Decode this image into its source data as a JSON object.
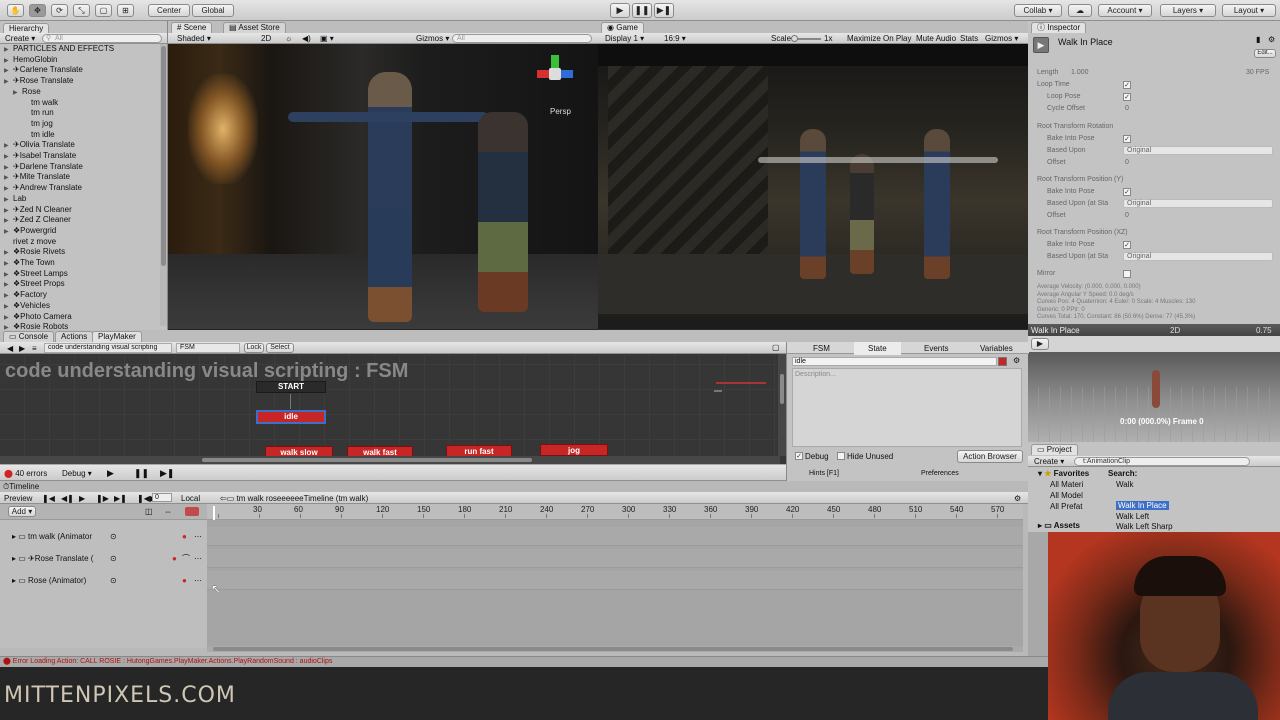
{
  "toolbar": {
    "center_label": "Center",
    "global_label": "Global",
    "collab_label": "Collab",
    "account_label": "Account",
    "layers_label": "Layers",
    "layout_label": "Layout"
  },
  "hierarchy": {
    "tab": "Hierarchy",
    "create_label": "Create",
    "search_placeholder": "All",
    "items": [
      {
        "label": "PARTICLES AND EFFECTS",
        "indent": 1,
        "arrow": true
      },
      {
        "label": "HemoGlobin",
        "indent": 1,
        "arrow": true
      },
      {
        "label": "✈Carlene Translate",
        "indent": 1,
        "arrow": true
      },
      {
        "label": "✈Rose Translate",
        "indent": 1,
        "arrow": true
      },
      {
        "label": "Rose",
        "indent": 2,
        "arrow": true
      },
      {
        "label": "tm walk",
        "indent": 3,
        "arrow": false
      },
      {
        "label": "tm run",
        "indent": 3,
        "arrow": false
      },
      {
        "label": "tm jog",
        "indent": 3,
        "arrow": false
      },
      {
        "label": "tm idle",
        "indent": 3,
        "arrow": false
      },
      {
        "label": "✈Olivia Translate",
        "indent": 1,
        "arrow": true
      },
      {
        "label": "✈Isabel Translate",
        "indent": 1,
        "arrow": true
      },
      {
        "label": "✈Darlene Translate",
        "indent": 1,
        "arrow": true
      },
      {
        "label": "✈Mite Translate",
        "indent": 1,
        "arrow": true
      },
      {
        "label": "✈Andrew Translate",
        "indent": 1,
        "arrow": true
      },
      {
        "label": "Lab",
        "indent": 1,
        "arrow": true
      },
      {
        "label": "✈Zed N Cleaner",
        "indent": 1,
        "arrow": true
      },
      {
        "label": "✈Zed Z Cleaner",
        "indent": 1,
        "arrow": true
      },
      {
        "label": "❖Powergrid",
        "indent": 1,
        "arrow": true
      },
      {
        "label": "rivet z move",
        "indent": 1,
        "arrow": false
      },
      {
        "label": "❖Rosie Rivets",
        "indent": 1,
        "arrow": true
      },
      {
        "label": "❖The Town",
        "indent": 1,
        "arrow": true
      },
      {
        "label": "❖Street Lamps",
        "indent": 1,
        "arrow": true
      },
      {
        "label": "❖Street Props",
        "indent": 1,
        "arrow": true
      },
      {
        "label": "❖Factory",
        "indent": 1,
        "arrow": true
      },
      {
        "label": "❖Vehicles",
        "indent": 1,
        "arrow": true
      },
      {
        "label": "❖Photo Camera",
        "indent": 1,
        "arrow": true
      },
      {
        "label": "❖Rosie Robots",
        "indent": 1,
        "arrow": true
      }
    ]
  },
  "scene": {
    "tab_scene": "Scene",
    "tab_asset_store": "Asset Store",
    "shaded": "Shaded",
    "mode_2d": "2D",
    "gizmos": "Gizmos",
    "search_placeholder": "All",
    "persp": "Persp"
  },
  "game": {
    "tab": "Game",
    "display": "Display 1",
    "aspect": "16:9",
    "scale_label": "Scale",
    "scale_value": "1x",
    "maximize": "Maximize On Play",
    "mute": "Mute Audio",
    "stats": "Stats",
    "gizmos": "Gizmos"
  },
  "inspector": {
    "tab": "Inspector",
    "title": "Walk In Place",
    "edit": "Edit...",
    "length_label": "Length",
    "length_value": "1.000",
    "fps": "30 FPS",
    "loop_time": "Loop Time",
    "loop_pose": "Loop Pose",
    "cycle_offset": "Cycle Offset",
    "cycle_offset_value": "0",
    "rtr_header": "Root Transform Rotation",
    "bake_into_pose": "Bake Into Pose",
    "based_upon": "Based Upon",
    "based_upon_value": "Original",
    "offset": "Offset",
    "offset_value": "0",
    "rty_header": "Root Transform Position (Y)",
    "based_upon_start": "Based Upon (at Sta",
    "rtxz_header": "Root Transform Position (XZ)",
    "mirror": "Mirror",
    "stats": [
      "Average Velocity: (0.000, 0.000, 0.000)",
      "Average Angular Y Speed: 0.0 deg/s",
      "Curves Pos: 4 Quaternion: 4 Euler: 0 Scale: 4 Muscles: 130",
      "Generic: 0 PPtr: 0",
      "Curves Total: 170, Constant: 86 (50.6%) Dense: 77 (45.3%)"
    ]
  },
  "preview": {
    "title": "Walk In Place",
    "mode_2d": "2D",
    "speed": "0.75",
    "frame_text": "0:00 (000.0%) Frame 0"
  },
  "tabs_bottom": {
    "console": "Console",
    "actions": "Actions",
    "playmaker": "PlayMaker"
  },
  "playmaker": {
    "fsm_path": "code understanding visual scripting",
    "fsm_name": "FSM",
    "lock": "Lock",
    "select": "Select",
    "canvas_title": "code understanding visual scripting : FSM",
    "start": "START",
    "states": [
      "idle",
      "walk slow",
      "walk fast",
      "run fast",
      "jog"
    ],
    "errors": "40 errors",
    "debug": "Debug",
    "panel_tabs": [
      "FSM",
      "State",
      "Events",
      "Variables"
    ],
    "state_name": "idle",
    "description_placeholder": "Description...",
    "debug_check": "Debug",
    "hide_unused": "Hide Unused",
    "action_browser": "Action Browser",
    "hints": "Hints [F1]",
    "preferences": "Preferences"
  },
  "timeline": {
    "tab": "Timeline",
    "preview": "Preview",
    "frame": "0",
    "local": "Local",
    "asset": "tm walk roseeeeeeTimeline (tm walk)",
    "add": "Add",
    "ruler": [
      "30",
      "60",
      "90",
      "120",
      "150",
      "180",
      "210",
      "240",
      "270",
      "300",
      "330",
      "360",
      "390",
      "420",
      "450",
      "480",
      "510",
      "540",
      "570"
    ],
    "tracks": [
      "tm walk (Animator",
      "✈Rose Translate (",
      "Rose (Animator)"
    ]
  },
  "project": {
    "tab": "Project",
    "create": "Create",
    "search_value": "t:AnimationClip",
    "favorites": "Favorites",
    "fav_items": [
      "All Materi",
      "All Model",
      "All Prefat"
    ],
    "assets": "Assets",
    "search_label": "Search:",
    "results": [
      "Walk",
      "Walk In Place",
      "Walk Left",
      "Walk Left Sharp"
    ]
  },
  "status": {
    "error": "Error Loading Action: CALL ROSIE : HutongGames.PlayMaker.Actions.PlayRandomSound : audioClips"
  },
  "watermark": {
    "text": "MITTENPIXELS.COM"
  },
  "colors": {
    "state_red": "#c62626",
    "accent_blue": "#3d6fc6",
    "error_red": "#d32222"
  }
}
